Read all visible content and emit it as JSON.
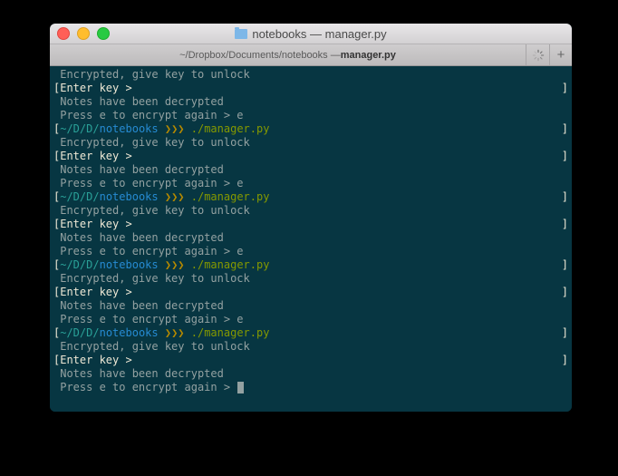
{
  "window": {
    "title": "notebooks — manager.py"
  },
  "tabbar": {
    "path": "~/Dropbox/Documents/notebooks — ",
    "file": "manager.py",
    "newTabLabel": "+"
  },
  "prompt": {
    "bracketL": "[",
    "bracketR": "]",
    "path1": "~/D/D/",
    "path2": "notebooks",
    "arrows": " ❯❯❯ ",
    "cmd": "./manager.py"
  },
  "msg": {
    "encrypted": " Encrypted, give key to unlock",
    "enterKeyL": "[Enter key >",
    "decrypted": " Notes have been decrypted",
    "pressE": " Press e to encrypt again > e",
    "pressENoInput": " Press e to encrypt again > "
  }
}
